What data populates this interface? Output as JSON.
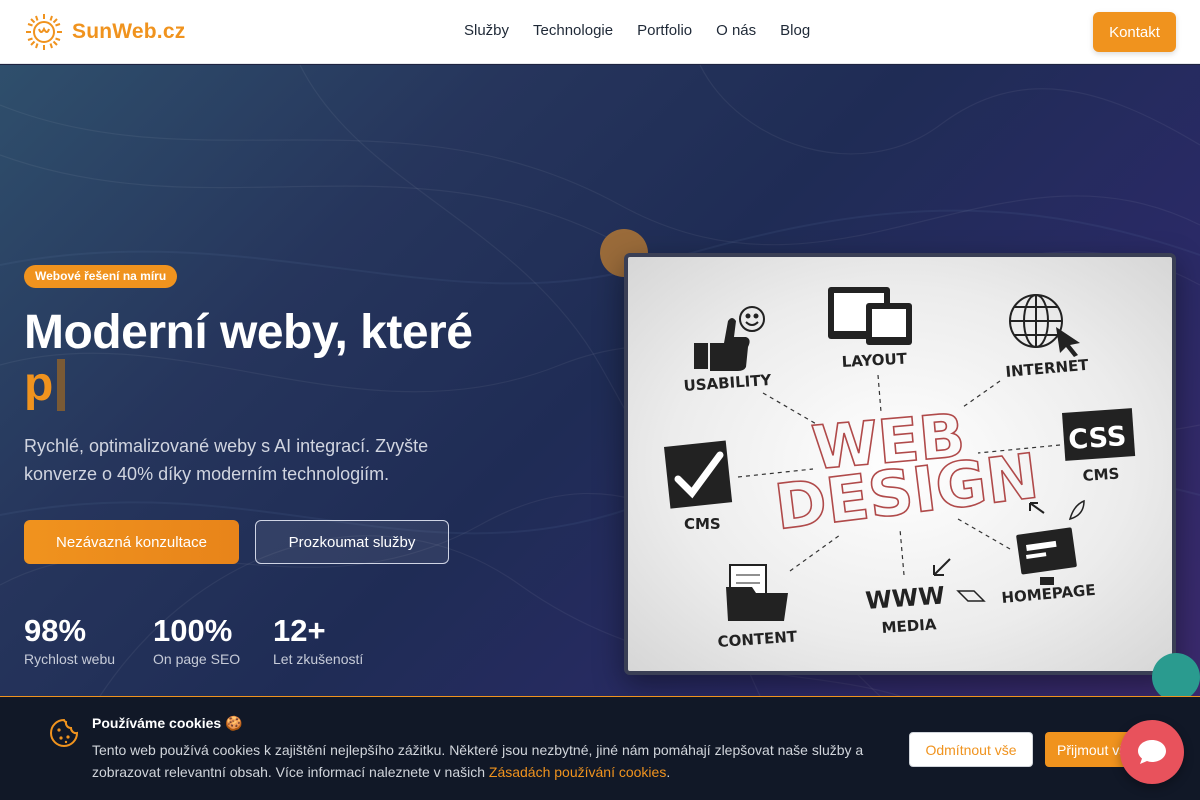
{
  "header": {
    "logo_text": "SunWeb.cz",
    "nav": [
      "Služby",
      "Technologie",
      "Portfolio",
      "O nás",
      "Blog"
    ],
    "contact_label": "Kontakt"
  },
  "hero": {
    "badge": "Webové řešení na míru",
    "headline": "Moderní weby, které",
    "typed_text": "p",
    "subtitle": "Rychlé, optimalizované weby s AI integrací. Zvyšte konverze o 40% díky moderním technologiím.",
    "primary_button": "Nezávazná konzultace",
    "secondary_button": "Prozkoumat služby",
    "stats": [
      {
        "value": "98%",
        "label": "Rychlost webu"
      },
      {
        "value": "100%",
        "label": "On page SEO"
      },
      {
        "value": "12+",
        "label": "Let zkušeností"
      }
    ],
    "image_labels": {
      "usability": "USABILITY",
      "layout": "LAYOUT",
      "internet": "INTERNET",
      "web": "WEB",
      "design": "DESIGN",
      "css": "CSS",
      "cms_right": "CMS",
      "cms_left": "CMS",
      "content": "CONTENT",
      "www": "WWW",
      "media": "MEDIA",
      "homepage": "HOMEPAGE"
    }
  },
  "cookie": {
    "title": "Používáme cookies 🍪",
    "text": "Tento web používá cookies k zajištění nejlepšího zážitku. Některé jsou nezbytné, jiné nám pomáhají zlepšovat naše služby a zobrazovat relevantní obsah. Více informací naleznete v našich ",
    "link": "Zásadách používání cookies",
    "text_end": ".",
    "decline": "Odmítnout vše",
    "accept": "Přijmout vše"
  },
  "colors": {
    "accent": "#f0931e",
    "chat": "#e8525c",
    "cookie_bg": "#111827"
  }
}
